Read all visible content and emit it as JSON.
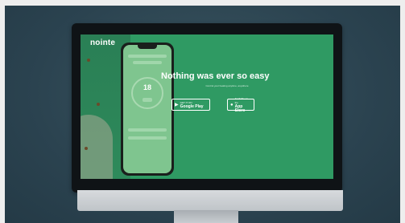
{
  "scene": {
    "background": "#2b4350"
  },
  "website": {
    "brand": "nointe",
    "brand_tagline": "",
    "headline": "Nothing was ever so easy",
    "subtext": "Control your heating anytime, anywhere",
    "google_button": {
      "small": "GET IT ON",
      "big": "Google Play"
    },
    "apple_button": {
      "small": "Available on the",
      "big": "App Store"
    },
    "accent": "#2f9a63"
  },
  "phone": {
    "temperature": "18"
  }
}
